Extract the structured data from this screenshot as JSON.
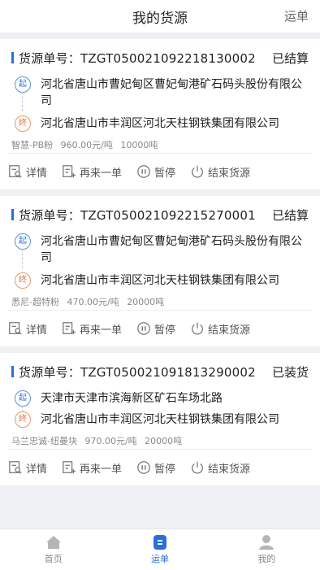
{
  "header": {
    "title": "我的货源",
    "right_link": "运单"
  },
  "cards": [
    {
      "number": "货源单号：TZGT050021092218130002",
      "status": "已结算",
      "from": "河北省唐山市曹妃甸区曹妃甸港矿石码头股份有限公司",
      "to": "河北省唐山市丰润区河北天柱钢铁集团有限公司",
      "goods": "智慧-PB粉",
      "price": "960.00元/吨",
      "quantity": "10000吨"
    },
    {
      "number": "货源单号：TZGT050021092215270001",
      "status": "已结算",
      "from": "河北省唐山市曹妃甸区曹妃甸港矿石码头股份有限公司",
      "to": "河北省唐山市丰润区河北天柱钢铁集团有限公司",
      "goods": "悉尼-超特粉",
      "price": "470.00元/吨",
      "quantity": "20000吨"
    },
    {
      "number": "货源单号：TZGT050021091813290002",
      "status": "已装货",
      "from": "天津市天津市滨海新区矿石车场北路",
      "to": "河北省唐山市丰润区河北天柱钢铁集团有限公司",
      "goods": "马兰忠诚-纽曼块",
      "price": "970.00元/吨",
      "quantity": "20000吨"
    }
  ],
  "labels": {
    "origin_tag": "起",
    "dest_tag": "终"
  },
  "actions": {
    "detail": "详情",
    "again": "再来一单",
    "pause": "暂停",
    "end": "结束货源"
  },
  "tabbar": {
    "home": "首页",
    "waybill": "运单",
    "mine": "我的"
  },
  "colors": {
    "accent": "#2a6fd6",
    "origin_tag": "#5b92d8",
    "dest_tag": "#e59a6a"
  }
}
